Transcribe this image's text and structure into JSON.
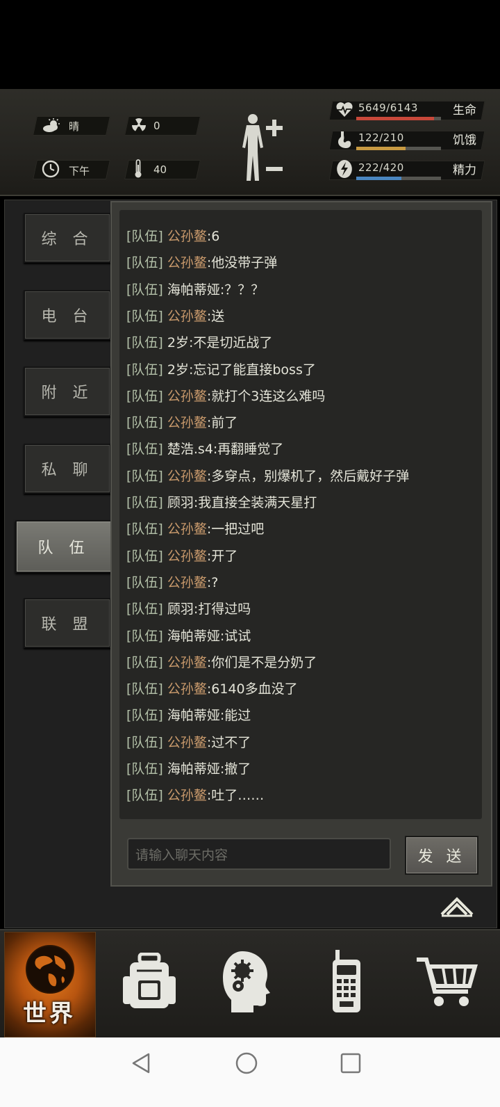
{
  "hud": {
    "weather": "晴",
    "radiation": "0",
    "time_of_day": "下午",
    "temperature": "40",
    "stats": [
      {
        "value": "5649/6143",
        "label": "生命",
        "fraction": 0.92,
        "color": "#c8483a"
      },
      {
        "value": "122/210",
        "label": "饥饿",
        "fraction": 0.58,
        "color": "#c89a42"
      },
      {
        "value": "222/420",
        "label": "精力",
        "fraction": 0.53,
        "color": "#4a86c0"
      }
    ]
  },
  "tabs": [
    "综 合",
    "电 台",
    "附 近",
    "私 聊",
    "队 伍",
    "联 盟"
  ],
  "active_tab_index": 4,
  "chat": {
    "channel": "[队伍]",
    "messages": [
      {
        "name": "公孙鳌",
        "text": ":6",
        "self": true
      },
      {
        "name": "公孙鳌",
        "text": ":他没带子弹",
        "self": true
      },
      {
        "name": "海帕蒂娅",
        "text": ":？？？",
        "self": false
      },
      {
        "name": "公孙鳌",
        "text": ":送",
        "self": true
      },
      {
        "name": "2岁",
        "text": ":不是切近战了",
        "self": false
      },
      {
        "name": "2岁",
        "text": ":忘记了能直接boss了",
        "self": false
      },
      {
        "name": "公孙鳌",
        "text": ":就打个3连这么难吗",
        "self": true
      },
      {
        "name": "公孙鳌",
        "text": ":前了",
        "self": true
      },
      {
        "name": "楚浩.s4",
        "text": ":再翻睡觉了",
        "self": false
      },
      {
        "name": "公孙鳌",
        "text": ":多穿点，别爆机了，然后戴好子弹",
        "self": true
      },
      {
        "name": "顾羽",
        "text": ":我直接全装满天星打",
        "self": false
      },
      {
        "name": "公孙鳌",
        "text": ":一把过吧",
        "self": true
      },
      {
        "name": "公孙鳌",
        "text": ":开了",
        "self": true
      },
      {
        "name": "公孙鳌",
        "text": ":?",
        "self": true
      },
      {
        "name": "顾羽",
        "text": ":打得过吗",
        "self": false
      },
      {
        "name": "海帕蒂娅",
        "text": ":试试",
        "self": false
      },
      {
        "name": "公孙鳌",
        "text": ":你们是不是分奶了",
        "self": true
      },
      {
        "name": "公孙鳌",
        "text": ":6140多血没了",
        "self": true
      },
      {
        "name": "海帕蒂娅",
        "text": ":能过",
        "self": false
      },
      {
        "name": "公孙鳌",
        "text": ":过不了",
        "self": true
      },
      {
        "name": "海帕蒂娅",
        "text": ":撤了",
        "self": false
      },
      {
        "name": "公孙鳌",
        "text": ":吐了……",
        "self": true
      }
    ],
    "input_placeholder": "请输入聊天内容",
    "send_label": "发 送"
  },
  "bottom_nav": {
    "world_label": "世界",
    "items": [
      "globe-icon",
      "backpack-icon",
      "head-gears-icon",
      "walkie-talkie-icon",
      "shopping-cart-icon"
    ]
  }
}
